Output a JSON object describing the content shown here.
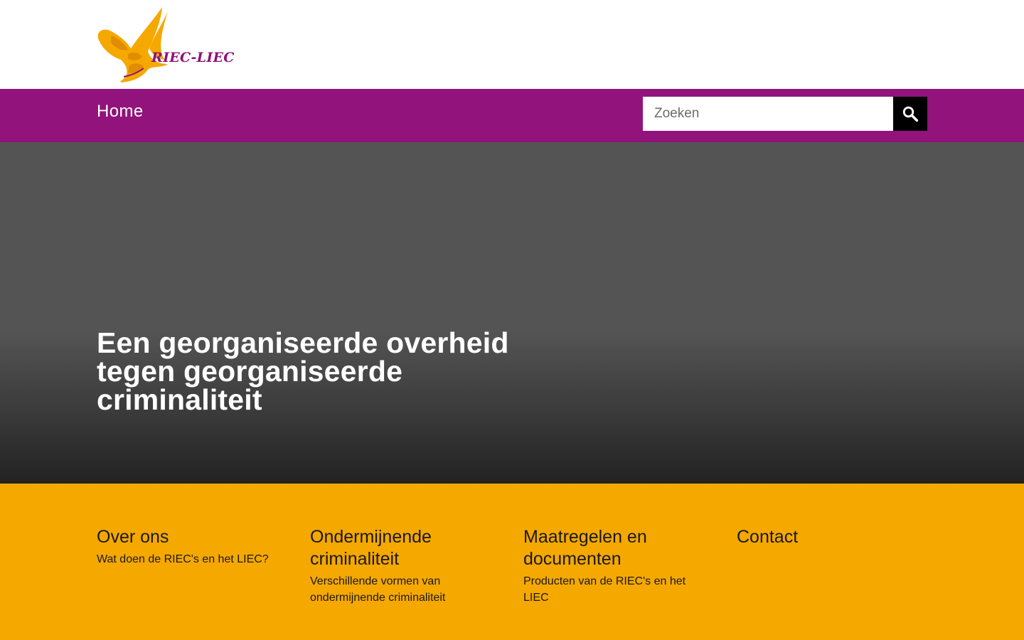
{
  "logo": {
    "text": "RIEC-LIEC",
    "colors": {
      "bird": "#f5a800",
      "bird_dark": "#e08e00",
      "text": "#8e1277"
    }
  },
  "nav": {
    "home_label": "Home",
    "search_placeholder": "Zoeken",
    "search_icon": "search-icon",
    "bar_color": "#91137b"
  },
  "hero": {
    "title": "Een georganiseerde overheid tegen georganiseerde criminaliteit"
  },
  "footer": {
    "background": "#f5a800",
    "columns": [
      {
        "title": "Over ons",
        "description": "Wat doen de RIEC's en het LIEC?"
      },
      {
        "title": "Ondermijnende criminaliteit",
        "description": "Verschillende vormen van ondermijnende criminaliteit"
      },
      {
        "title": "Maatregelen en documenten",
        "description": "Producten van de RIEC's en het LIEC"
      },
      {
        "title": "Contact",
        "description": ""
      }
    ]
  }
}
